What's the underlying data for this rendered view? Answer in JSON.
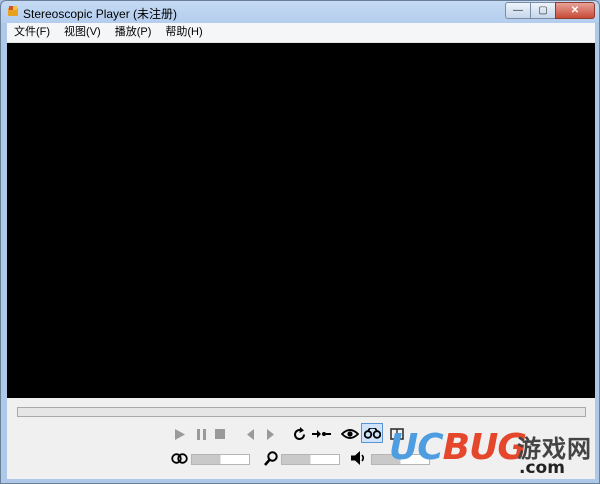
{
  "window": {
    "title": "Stereoscopic Player (未注册)",
    "min_glyph": "—",
    "max_glyph": "▢",
    "close_glyph": "✕"
  },
  "menu": [
    {
      "label": "文件(F)"
    },
    {
      "label": "视图(V)"
    },
    {
      "label": "播放(P)"
    },
    {
      "label": "帮助(H)"
    }
  ],
  "controls": {
    "seek_progress": 0,
    "icons": {
      "play": "play-icon",
      "pause": "pause-icon",
      "stop": "stop-icon",
      "prev": "previous-frame-icon",
      "next": "next-frame-icon",
      "loop": "loop-icon",
      "swap": "swap-eyes-icon",
      "eye": "eye-icon",
      "glasses": "stereo-glasses-icon",
      "anaglyph": "anaglyph-icon",
      "zoom": "zoom-icon",
      "volume": "volume-icon"
    },
    "parallax_level": 0.5,
    "zoom_level": 0.5,
    "volume_level": 0.5
  },
  "watermark": {
    "uc": "UC",
    "bug": "BUG",
    "site": "游戏网",
    "domain": ".com"
  },
  "colors": {
    "video_bg": "#000000",
    "frame": "#aec8ea",
    "watermark_blue": "#4d9de0",
    "watermark_red": "#e4472b"
  }
}
